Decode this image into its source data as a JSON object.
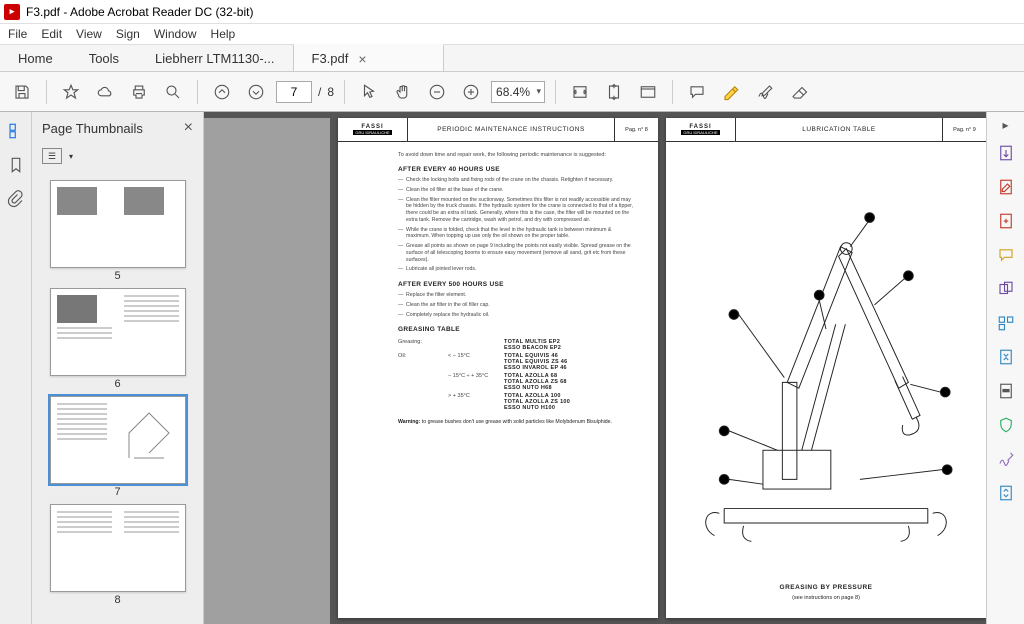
{
  "window": {
    "title": "F3.pdf - Adobe Acrobat Reader DC (32-bit)"
  },
  "menubar": {
    "file": "File",
    "edit": "Edit",
    "view": "View",
    "sign": "Sign",
    "window": "Window",
    "help": "Help"
  },
  "tabbar": {
    "home": "Home",
    "tools": "Tools",
    "tab1": "Liebherr LTM1130-...",
    "tab2": "F3.pdf"
  },
  "toolbar": {
    "page_current": "7",
    "page_sep": "/",
    "page_total": "8",
    "zoom": "68.4%"
  },
  "sidebar": {
    "title": "Page Thumbnails"
  },
  "thumbs": {
    "n5": "5",
    "n6": "6",
    "n7": "7",
    "n8": "8"
  },
  "doc": {
    "brand": "FASSI",
    "brand_sub": "GRU IDRAULICHE",
    "left": {
      "title": "PERIODIC MAINTENANCE INSTRUCTIONS",
      "pag": "Pag. n° 8",
      "intro": "To avoid down time and repair work, the following periodic maintenance is suggested:",
      "h1": "AFTER EVERY 40 HOURS USE",
      "i1": "Check the locking bolts and fixing rods of the crane on the chassis. Retighten if necessary.",
      "i2": "Clean the oil filter at the base of the crane.",
      "i3": "Clean the filter mounted on the suctionway. Sometimes this filter is not readily accessible and may be hidden by the truck chassis. If the hydraulic system for the crane is connected to that of a tipper, there could be an extra oil tank. Generally, where this is the case, the filter will be mounted on the extra tank. Remove the cartridge, wash with petrol, and dry with compressed air.",
      "i4": "While the crane is folded, check that the level in the hydraulic tank is between minimum & maximum. When topping up use only the oil shown on the proper table.",
      "i5": "Grease all points as shown on page 9 including the points not easily visible. Spread grease on the surface of all telescoping booms to ensure easy movement (remove all sand, grit etc from these surfaces).",
      "i6": "Lubricate all jointed lever rods.",
      "h2": "AFTER EVERY 500 HOURS USE",
      "j1": "Replace the filter element.",
      "j2": "Clean the air filter in the oil filler cap.",
      "j3": "Completely replace the hydraulic oil.",
      "h3": "GREASING TABLE",
      "g_greasing": "Greasing:",
      "g_oil": "Oil:",
      "g_t1": "< − 15°C",
      "g_t2": "− 15°C ÷ + 35°C",
      "g_t3": "> + 35°C",
      "p_g1": "TOTAL MULTIS EP2",
      "p_g2": "ESSO BEACON EP2",
      "p_a1": "TOTAL EQUIVIS 46",
      "p_a2": "TOTAL EQUIVIS ZS 46",
      "p_a3": "ESSO INVAROL EP 46",
      "p_b1": "TOTAL AZOLLA 68",
      "p_b2": "TOTAL AZOLLA ZS 68",
      "p_b3": "ESSO NUTO H68",
      "p_c1": "TOTAL AZOLLA 100",
      "p_c2": "TOTAL AZOLLA ZS 100",
      "p_c3": "ESSO NUTO H100",
      "warn_lead": "Warning:",
      "warn_txt": "to grease bushes don't use grease with solid particles like Molybdenum Bisulphide."
    },
    "right": {
      "title": "LUBRICATION TABLE",
      "pag": "Pag. n° 9",
      "caption": "GREASING BY PRESSURE",
      "note": "(see instructions on page 8)"
    }
  }
}
